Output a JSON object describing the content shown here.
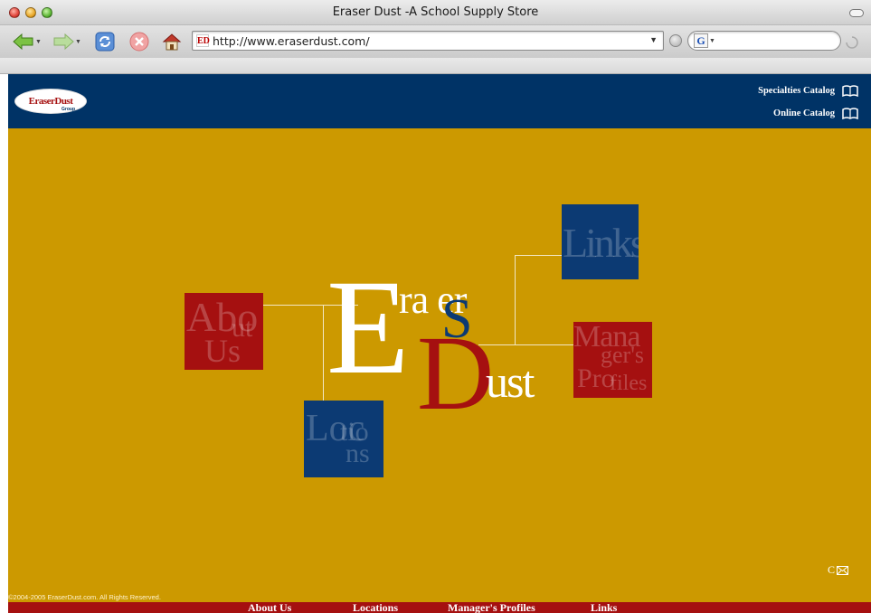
{
  "window": {
    "title": "Eraser Dust -A School Supply Store"
  },
  "toolbar": {
    "url": "http://www.eraserdust.com/",
    "favicon_text": "ED",
    "search_placeholder": "",
    "search_engine_letter": "G"
  },
  "icons": {
    "back": "back-arrow-icon",
    "forward": "forward-arrow-icon",
    "reload": "reload-icon",
    "stop": "stop-icon",
    "home": "home-icon",
    "book": "book-icon",
    "mail": "mail-icon"
  },
  "header": {
    "logo_text": "EraserDust",
    "logo_sub": "Group",
    "specialties_catalog": "Specialties Catalog",
    "online_catalog": "Online Catalog"
  },
  "art": {
    "e": "E",
    "rar": "ra er",
    "s": "S",
    "d": "D",
    "ust": "ust",
    "about_tile_lines": [
      "Abo",
      "ut",
      "Us"
    ],
    "locations_tile_lines": [
      "Loc",
      "tio",
      "ns"
    ],
    "links_tile_lines": [
      "Links"
    ],
    "managers_tile_lines": [
      "Mana",
      "ger's",
      "Pro",
      "files"
    ]
  },
  "contact": {
    "label": "C"
  },
  "copyright": "©2004-2005 EraserDust.com. All Rights Reserved.",
  "footer_nav": {
    "about": "About Us",
    "locations": "Locations",
    "managers": "Manager's Profiles",
    "links": "Links"
  },
  "colors": {
    "page_bg": "#cc9900",
    "header_bg": "#003366",
    "red": "#a51010",
    "blue": "#0c3a73"
  }
}
